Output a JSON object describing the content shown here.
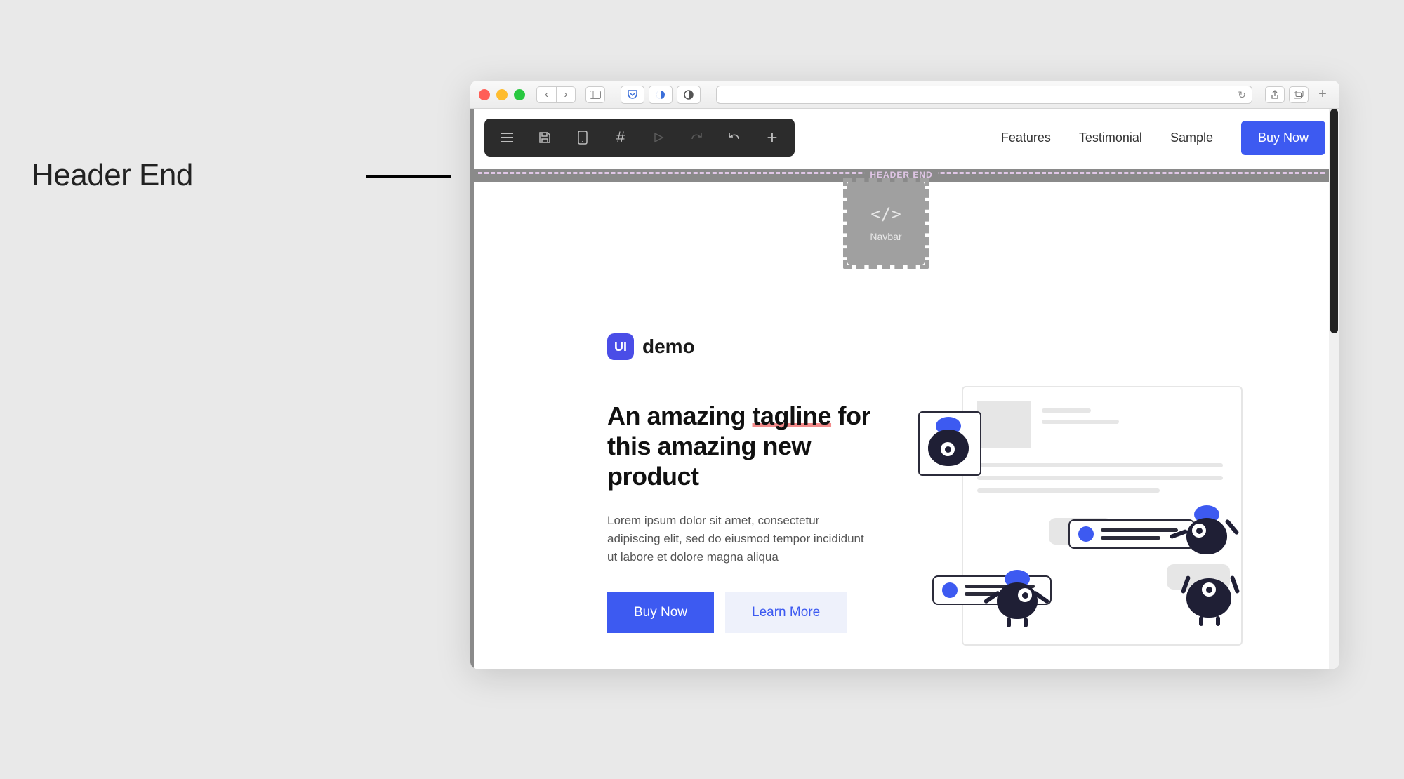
{
  "annotation": {
    "label": "Header End"
  },
  "browser": {
    "url_hint": "",
    "toolbar_icons": {
      "back": "‹",
      "forward": "›",
      "sidebar": "▢",
      "pocket": "⌄",
      "shield": "◐",
      "reader": "◐",
      "reload": "↻",
      "share": "⇪",
      "tabs": "⧉",
      "add": "+"
    }
  },
  "editor_toolbar": {
    "icons": [
      "menu",
      "save",
      "mobile",
      "hash",
      "play",
      "redo",
      "undo",
      "plus"
    ]
  },
  "header_end_marker": {
    "label": "HEADER END"
  },
  "navbar_placeholder": {
    "icon": "</>",
    "label": "Navbar"
  },
  "site_nav": {
    "items": [
      "Features",
      "Testimonial",
      "Sample"
    ],
    "cta": "Buy Now"
  },
  "hero": {
    "logo_badge": "UI",
    "logo_text": "demo",
    "title_pre": "An amazing ",
    "title_tagline": "tagline",
    "title_post": " for this amazing new product",
    "body": "Lorem ipsum dolor sit amet, consectetur adipiscing elit, sed do eiusmod tempor incididunt ut labore et dolore magna aliqua",
    "cta_primary": "Buy Now",
    "cta_secondary": "Learn More"
  },
  "colors": {
    "accent": "#3d5af1",
    "toolbar": "#2c2c2c",
    "marker": "#8a8a8a"
  }
}
